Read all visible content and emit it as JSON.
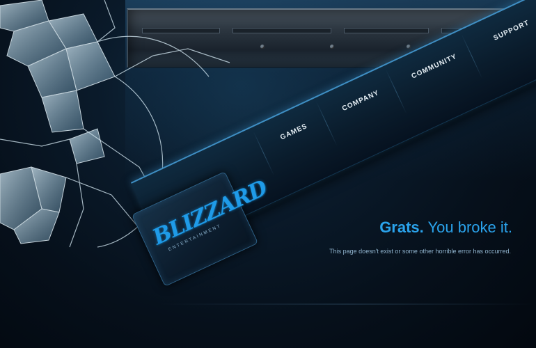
{
  "brand": {
    "logo_text": "BLIZZARD",
    "logo_subtext": "ENTERTAINMENT"
  },
  "nav": {
    "items": [
      {
        "label": "GAMES"
      },
      {
        "label": "COMPANY"
      },
      {
        "label": "COMMUNITY"
      },
      {
        "label": "SUPPORT"
      }
    ]
  },
  "error": {
    "headline_bold": "Grats.",
    "headline_rest": "You broke it.",
    "message": "This page doesn't exist or some other horrible error has occurred."
  },
  "colors": {
    "accent": "#2aa3ec",
    "background": "#06101b",
    "nav_border": "#3f8fc4",
    "message_text": "#8fb2cc"
  },
  "icons": [
    "broken-glass-graphic",
    "blizzard-logo"
  ]
}
